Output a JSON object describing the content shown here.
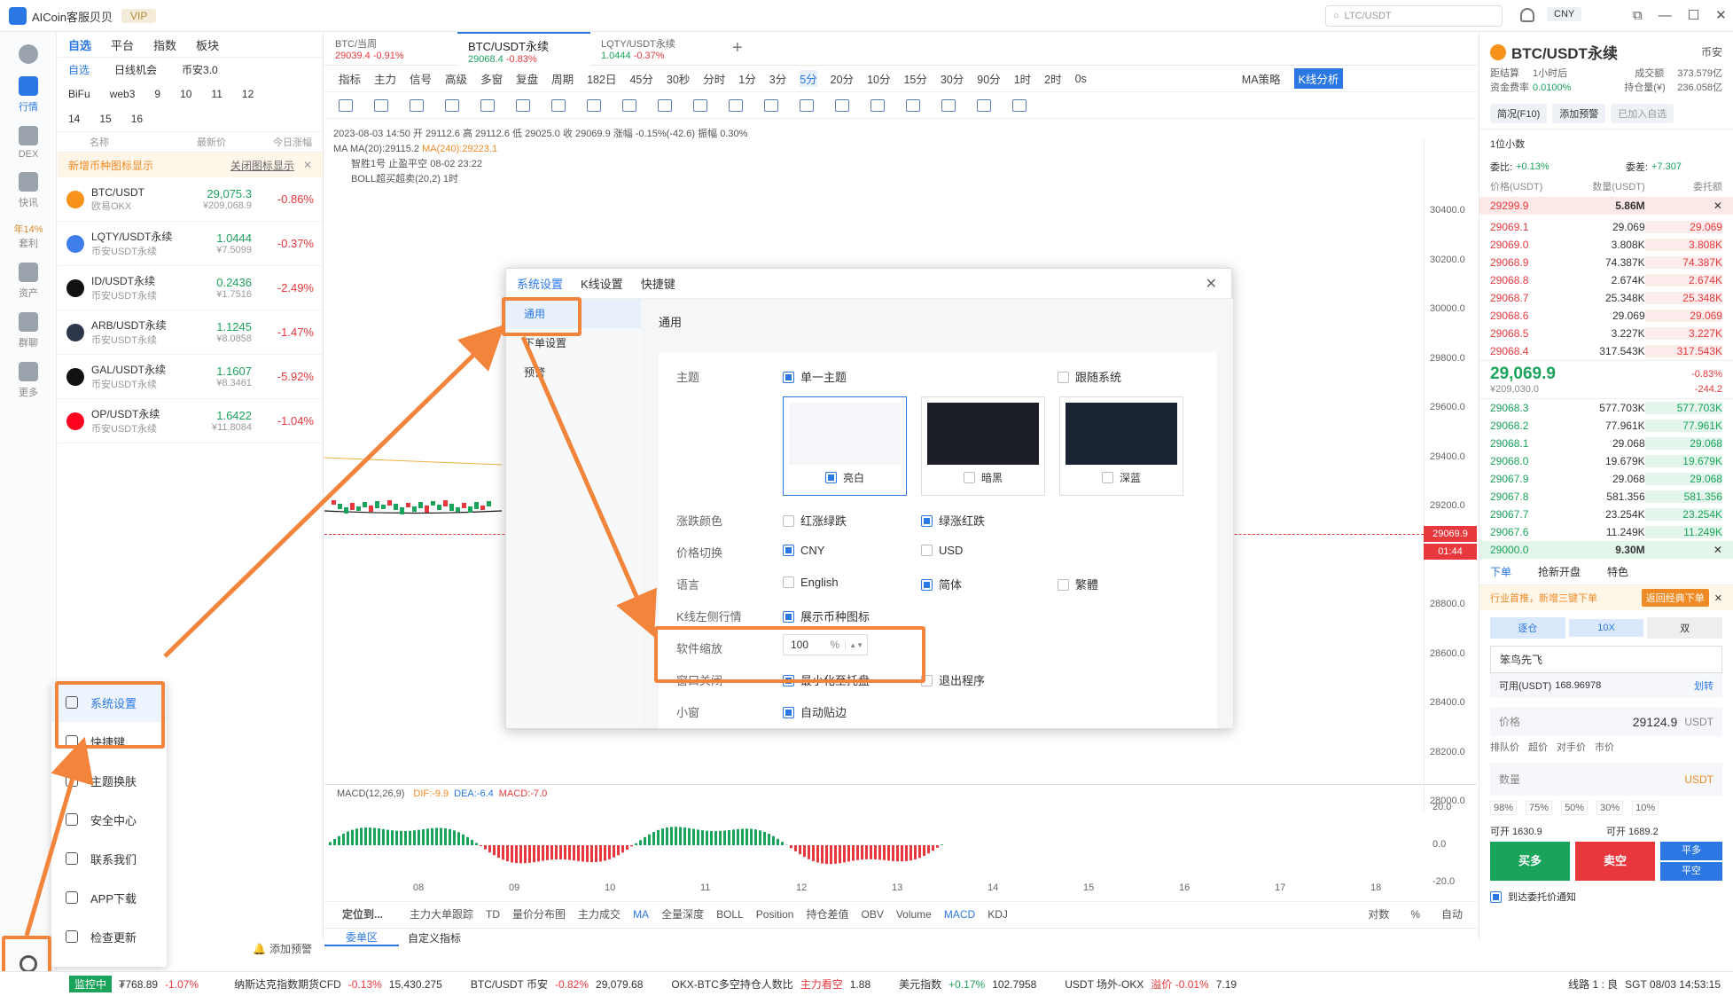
{
  "app": {
    "title": "AICoin客服贝贝",
    "vip": "VIP",
    "search_placeholder": "LTC/USDT",
    "currency": "CNY"
  },
  "leftnav": [
    {
      "label": "行情"
    },
    {
      "label": "DEX"
    },
    {
      "label": "快讯"
    },
    {
      "label": "年14%"
    },
    {
      "label": "套利"
    },
    {
      "label": "资产"
    },
    {
      "label": "群聊"
    },
    {
      "label": "更多"
    }
  ],
  "watch": {
    "tabs": [
      "自选",
      "平台",
      "指数",
      "板块"
    ],
    "subtabs": [
      "自选",
      "日线机会",
      "币安3.0"
    ],
    "groups": [
      "BiFu",
      "web3",
      "9",
      "10",
      "11",
      "12"
    ],
    "groups2": [
      "14",
      "15",
      "16"
    ],
    "col_name": "名称",
    "col_price": "最新价",
    "col_change": "今日涨幅",
    "notice": "新增币种图标显示",
    "notice_link": "关闭图标显示",
    "rows": [
      {
        "sym": "BTC/USDT",
        "ex": "欧易OKX",
        "price": "29,075.3",
        "cny": "¥209,068.9",
        "chg": "-0.86%",
        "color": "#f7931a"
      },
      {
        "sym": "LQTY/USDT永续",
        "ex": "币安USDT永续",
        "price": "1.0444",
        "cny": "¥7.5099",
        "chg": "-0.37%",
        "color": "#3d7ee8"
      },
      {
        "sym": "ID/USDT永续",
        "ex": "币安USDT永续",
        "price": "0.2436",
        "cny": "¥1.7516",
        "chg": "-2.49%",
        "color": "#111111"
      },
      {
        "sym": "ARB/USDT永续",
        "ex": "币安USDT永续",
        "price": "1.1245",
        "cny": "¥8.0858",
        "chg": "-1.47%",
        "color": "#2d374b"
      },
      {
        "sym": "GAL/USDT永续",
        "ex": "币安USDT永续",
        "price": "1.1607",
        "cny": "¥8.3461",
        "chg": "-5.92%",
        "color": "#111111"
      },
      {
        "sym": "OP/USDT永续",
        "ex": "币安USDT永续",
        "price": "1.6422",
        "cny": "¥11.8084",
        "chg": "-1.04%",
        "color": "#ff0420"
      }
    ],
    "add_alert": "添加预警"
  },
  "popup_menu": [
    {
      "label": "系统设置"
    },
    {
      "label": "快捷键"
    },
    {
      "label": "主题换肤"
    },
    {
      "label": "安全中心"
    },
    {
      "label": "联系我们"
    },
    {
      "label": "APP下载"
    },
    {
      "label": "检查更新"
    }
  ],
  "tabs": [
    {
      "name": "BTC/当周",
      "price": "29039.4",
      "chg": "-0.91%"
    },
    {
      "name": "BTC/USDT永续",
      "price": "29068.4",
      "chg": "-0.83%"
    },
    {
      "name": "LQTY/USDT永续",
      "price": "1.0444",
      "chg": "-0.37%"
    }
  ],
  "toolbar": {
    "items": [
      "指标",
      "主力",
      "信号",
      "高级",
      "多窗",
      "复盘",
      "周期",
      "182日",
      "45分",
      "30秒",
      "分时",
      "1分",
      "3分",
      "5分",
      "20分",
      "10分",
      "15分",
      "30分",
      "90分",
      "1时",
      "2时",
      "0s"
    ],
    "ma_strategy": "MA策略",
    "kline": "K线分析"
  },
  "chart_info": {
    "line1": "2023-08-03 14:50  开 29112.6  高 29112.6  低 29025.0  收 29069.9  涨幅 -0.15%(-42.6)  振幅 0.30%",
    "ma": "MA(20):29115.2",
    "ma240": "MA(240):29223.1",
    "line3": "智胜1号 止盈平空 08-02 23:22",
    "line4": "BOLL超买超卖(20,2) 1时",
    "yaxis": [
      "30400.0",
      "30200.0",
      "30000.0",
      "29800.0",
      "29600.0",
      "29400.0",
      "29200.0",
      "29000.0",
      "28800.0",
      "28600.0",
      "28400.0",
      "28200.0",
      "28000.0"
    ],
    "price_tag": "29069.9",
    "time_tag": "01:44"
  },
  "macd": {
    "label": "MACD(12,26,9)",
    "dif": "DIF:-9.9",
    "dea": "DEA:-6.4",
    "macd": "MACD:-7.0",
    "y": [
      "20.0",
      "0.0",
      "-20.0"
    ],
    "x": [
      "08",
      "09",
      "10",
      "11",
      "12",
      "13",
      "14",
      "15",
      "16",
      "17",
      "18"
    ]
  },
  "indicator_bar": [
    "定位到...",
    "主力大单跟踪",
    "TD",
    "量价分布图",
    "主力成交",
    "MA",
    "全量深度",
    "BOLL",
    "Position",
    "持仓差值",
    "OBV",
    "Volume",
    "MACD",
    "KDJ"
  ],
  "indicator_right": [
    "对数",
    "%",
    "自动"
  ],
  "bottom_tabs": [
    "委单区",
    "自定义指标"
  ],
  "dialog": {
    "tabs": [
      "系统设置",
      "K线设置",
      "快捷键"
    ],
    "side": [
      "通用",
      "下单设置",
      "预警"
    ],
    "section": "通用",
    "theme_label": "主题",
    "theme_single": "单一主题",
    "theme_follow": "跟随系统",
    "themes": [
      "亮白",
      "暗黑",
      "深蓝"
    ],
    "color_label": "涨跌颜色",
    "color_opt1": "红涨绿跌",
    "color_opt2": "绿涨红跌",
    "price_label": "价格切换",
    "price_opt1": "CNY",
    "price_opt2": "USD",
    "lang_label": "语言",
    "lang_opt1": "English",
    "lang_opt2": "简体",
    "lang_opt3": "繁體",
    "kline_label": "K线左侧行情",
    "kline_opt": "展示币种图标",
    "zoom_label": "软件缩放",
    "zoom_value": "100",
    "zoom_unit": "%",
    "close_label": "窗口关闭",
    "close_opt1": "最小化至托盘",
    "close_opt2": "退出程序",
    "partial_label": "小窗",
    "partial_opt": "自动贴边"
  },
  "right": {
    "title": "BTC/USDT永续",
    "exch": "币安",
    "funding_label": "距结算",
    "funding": "1小时后",
    "rate_label": "资金费率",
    "rate": "0.0100%",
    "vol_label": "成交额",
    "vol": "373.579亿",
    "oi_label": "持仓量(¥)",
    "oi": "236.058亿",
    "btn1": "简况(F10)",
    "btn2": "添加预警",
    "btn3": "已加入自选",
    "decimal": "1位小数",
    "wb_label": "委比:",
    "wb": "+0.13%",
    "wc_label": "委差:",
    "wc": "+7.307",
    "ob_head": [
      "价格(USDT)",
      "数量(USDT)",
      "委托额"
    ],
    "top_row": {
      "price": "29299.9",
      "qty": "5.86M"
    },
    "asks": [
      [
        "29069.1",
        "29.069",
        "29.069"
      ],
      [
        "29069.0",
        "3.808K",
        "3.808K"
      ],
      [
        "29068.9",
        "74.387K",
        "74.387K"
      ],
      [
        "29068.8",
        "2.674K",
        "2.674K"
      ],
      [
        "29068.7",
        "25.348K",
        "25.348K"
      ],
      [
        "29068.6",
        "29.069",
        "29.069"
      ],
      [
        "29068.5",
        "3.227K",
        "3.227K"
      ],
      [
        "29068.4",
        "317.543K",
        "317.543K"
      ]
    ],
    "mid_price": "29,069.9",
    "mid_cny": "¥209,030.0",
    "mid_chg": "-0.83%",
    "mid_diff": "-244.2",
    "bids": [
      [
        "29068.3",
        "577.703K",
        "577.703K"
      ],
      [
        "29068.2",
        "77.961K",
        "77.961K"
      ],
      [
        "29068.1",
        "29.068",
        "29.068"
      ],
      [
        "29068.0",
        "19.679K",
        "19.679K"
      ],
      [
        "29067.9",
        "29.068",
        "29.068"
      ],
      [
        "29067.8",
        "581.356",
        "581.356"
      ],
      [
        "29067.7",
        "23.254K",
        "23.254K"
      ],
      [
        "29067.6",
        "11.249K",
        "11.249K"
      ]
    ],
    "bottom_row": {
      "price": "29000.0",
      "qty": "9.30M"
    },
    "order_tabs": [
      "下单",
      "抢新开盘",
      "特色"
    ],
    "promo": "行业首推，新增三键下单",
    "promo_btn": "返回经典下单",
    "mode": [
      "逐仓",
      "10X",
      "双"
    ],
    "account": "笨鸟先飞",
    "avail_label": "可用(USDT)",
    "avail": "168.96978",
    "transfer": "划转",
    "price_label": "价格",
    "price_value": "29124.9",
    "price_unit": "USDT",
    "price_opts": [
      "排队价",
      "超价",
      "对手价",
      "市价"
    ],
    "qty_label": "数量",
    "qty_unit": "USDT",
    "pct": [
      "98%",
      "75%",
      "50%",
      "30%",
      "10%"
    ],
    "open_long": "可开 1630.9",
    "open_short": "可开 1689.2",
    "buy": "买多",
    "sell": "卖空",
    "close_long": "平多",
    "close_short": "平空",
    "notify": "到达委托价通知"
  },
  "bottombar": {
    "status": "监控中",
    "price": "₮768.89",
    "chg": "-1.07%",
    "t1": "纳斯达克指数期货CFD",
    "t1c": "-0.13%",
    "t1v": "15,430.275",
    "t2": "BTC/USDT 币安",
    "t2c": "-0.82%",
    "t2v": "29,079.68",
    "t3": "OKX-BTC多空持仓人数比",
    "t3c": "主力看空",
    "t3v": "1.88",
    "t4": "美元指数",
    "t4c": "+0.17%",
    "t4v": "102.7958",
    "t5": "USDT 场外-OKX",
    "t5c": "溢价 -0.01%",
    "t5v": "7.19",
    "line": "线路 1 : 良",
    "time": "SGT 08/03 14:53:15"
  }
}
